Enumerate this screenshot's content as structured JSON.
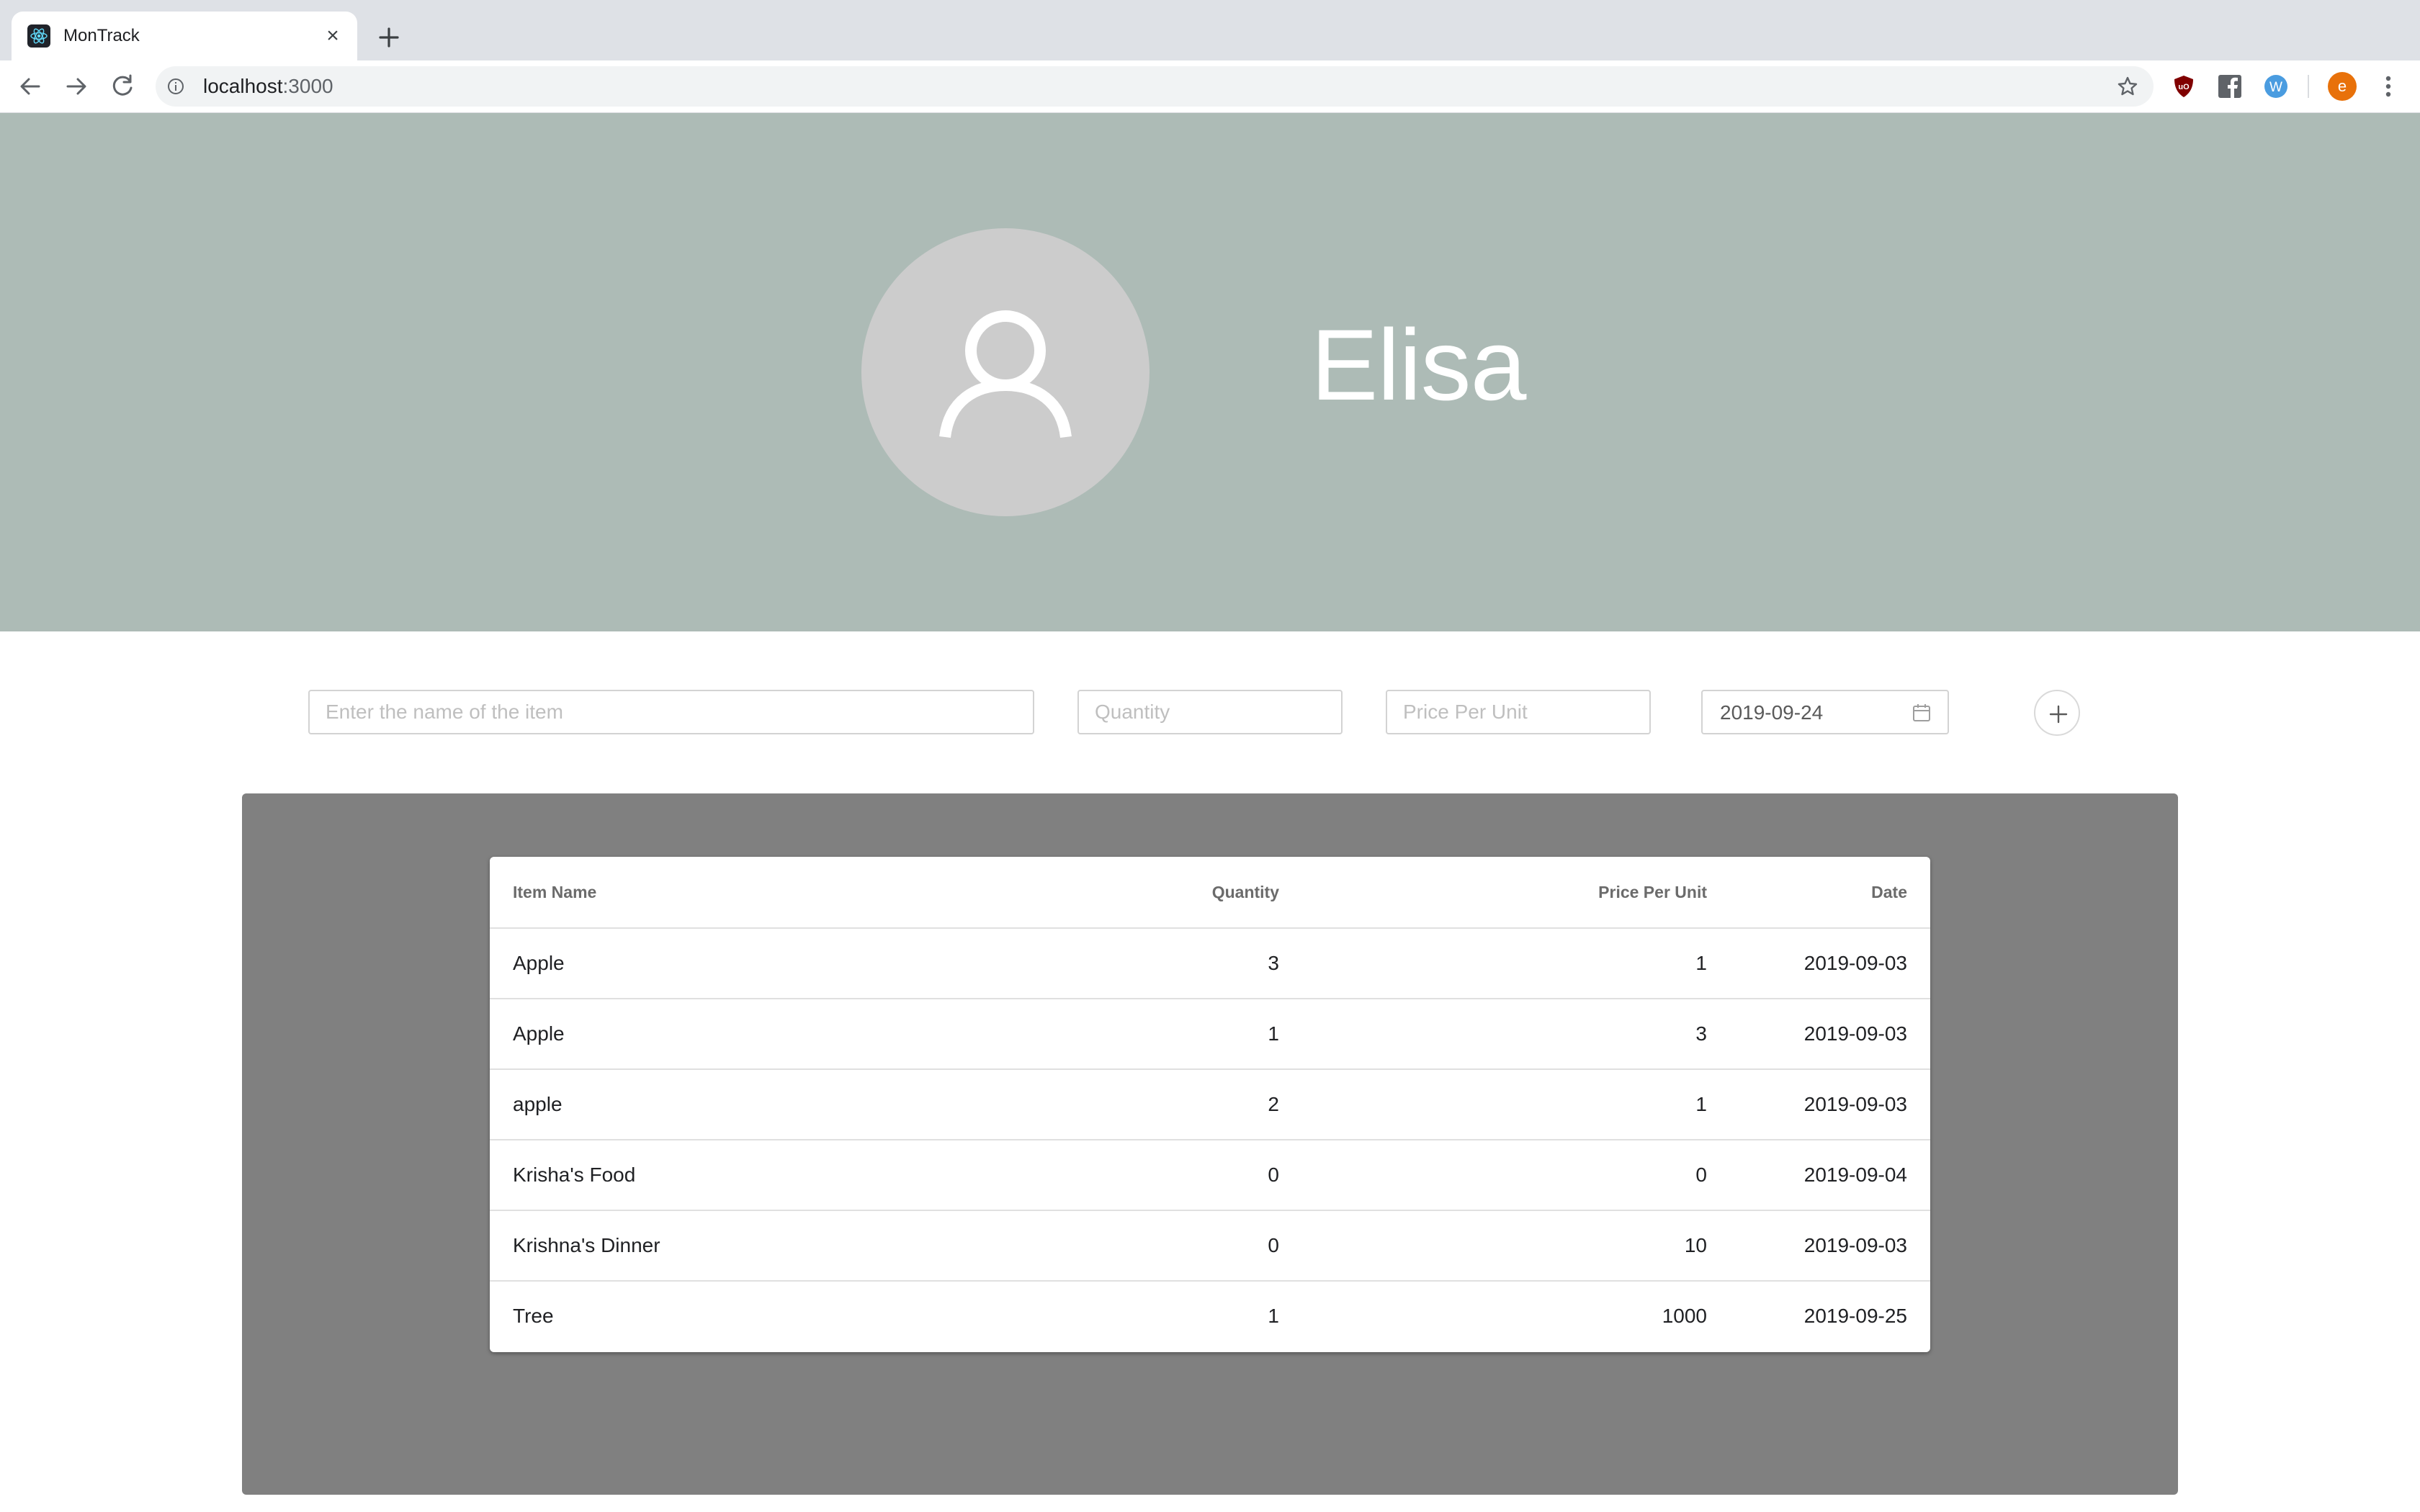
{
  "browser": {
    "tab_title": "MonTrack",
    "url_host": "localhost",
    "url_port": ":3000",
    "profile_initial": "e"
  },
  "profile": {
    "name": "Elisa"
  },
  "form": {
    "item_placeholder": "Enter the name of the item",
    "quantity_placeholder": "Quantity",
    "price_placeholder": "Price Per Unit",
    "date_value": "2019-09-24"
  },
  "table": {
    "headers": {
      "item_name": "Item Name",
      "quantity": "Quantity",
      "price_per_unit": "Price Per Unit",
      "date": "Date"
    },
    "rows": [
      {
        "name": "Apple",
        "quantity": "3",
        "price": "1",
        "date": "2019-09-03"
      },
      {
        "name": "Apple",
        "quantity": "1",
        "price": "3",
        "date": "2019-09-03"
      },
      {
        "name": "apple",
        "quantity": "2",
        "price": "1",
        "date": "2019-09-03"
      },
      {
        "name": "Krisha's Food",
        "quantity": "0",
        "price": "0",
        "date": "2019-09-04"
      },
      {
        "name": "Krishna's Dinner",
        "quantity": "0",
        "price": "10",
        "date": "2019-09-03"
      },
      {
        "name": "Tree",
        "quantity": "1",
        "price": "1000",
        "date": "2019-09-25"
      }
    ]
  },
  "colors": {
    "header_bg": "#adbbb6",
    "avatar_bg": "#cccccc",
    "panel_bg": "#808080"
  }
}
